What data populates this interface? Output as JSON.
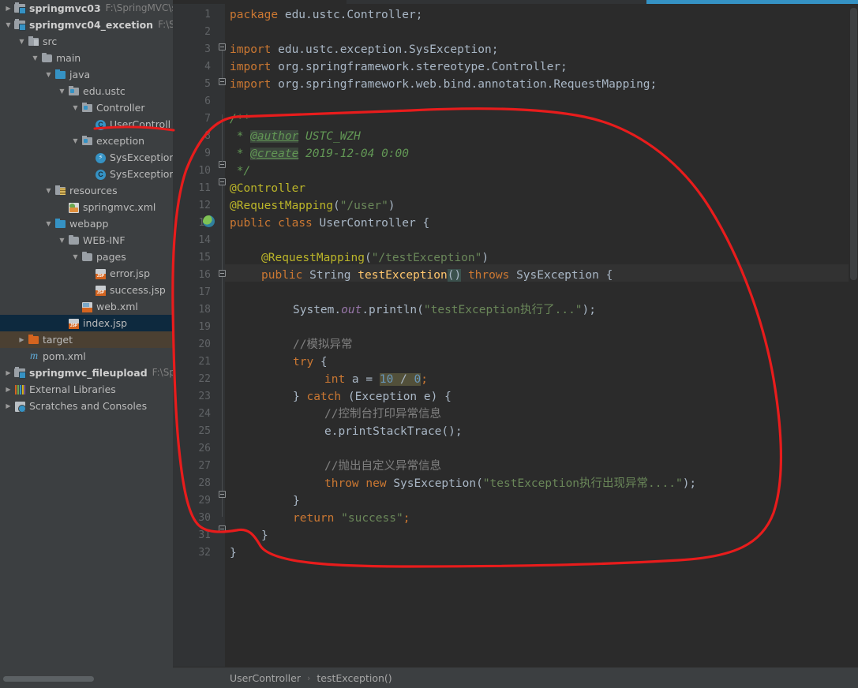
{
  "sidebar": {
    "items": [
      {
        "label": "springmvc03",
        "path": "F:\\SpringMVC\\s",
        "icon": "module-icon",
        "indent": 0,
        "arrow": "collapsed",
        "bold": true,
        "state": "normal"
      },
      {
        "label": "springmvc04_excetion",
        "path": "F:\\Spri",
        "icon": "module-icon",
        "indent": 0,
        "arrow": "expanded",
        "bold": true,
        "state": "normal"
      },
      {
        "label": "src",
        "path": "",
        "icon": "source-folder-icon",
        "indent": 1,
        "arrow": "expanded",
        "bold": false,
        "state": "normal"
      },
      {
        "label": "main",
        "path": "",
        "icon": "folder-icon",
        "indent": 2,
        "arrow": "expanded",
        "bold": false,
        "state": "normal"
      },
      {
        "label": "java",
        "path": "",
        "icon": "java-source-folder-icon",
        "indent": 3,
        "arrow": "expanded",
        "bold": false,
        "state": "normal"
      },
      {
        "label": "edu.ustc",
        "path": "",
        "icon": "package-icon",
        "indent": 4,
        "arrow": "expanded",
        "bold": false,
        "state": "normal"
      },
      {
        "label": "Controller",
        "path": "",
        "icon": "package-icon",
        "indent": 5,
        "arrow": "expanded",
        "bold": false,
        "state": "normal"
      },
      {
        "label": "UserControll",
        "path": "",
        "icon": "java-class-icon",
        "indent": 6,
        "arrow": "none",
        "bold": false,
        "state": "normal"
      },
      {
        "label": "exception",
        "path": "",
        "icon": "package-icon",
        "indent": 5,
        "arrow": "expanded",
        "bold": false,
        "state": "normal"
      },
      {
        "label": "SysException",
        "path": "",
        "icon": "exception-class-icon",
        "indent": 6,
        "arrow": "none",
        "bold": false,
        "state": "normal"
      },
      {
        "label": "SysException",
        "path": "",
        "icon": "java-class-icon",
        "indent": 6,
        "arrow": "none",
        "bold": false,
        "state": "normal"
      },
      {
        "label": "resources",
        "path": "",
        "icon": "resources-folder-icon",
        "indent": 3,
        "arrow": "expanded",
        "bold": false,
        "state": "normal"
      },
      {
        "label": "springmvc.xml",
        "path": "",
        "icon": "spring-config-icon",
        "indent": 4,
        "arrow": "none",
        "bold": false,
        "state": "normal"
      },
      {
        "label": "webapp",
        "path": "",
        "icon": "web-folder-icon",
        "indent": 3,
        "arrow": "expanded",
        "bold": false,
        "state": "normal"
      },
      {
        "label": "WEB-INF",
        "path": "",
        "icon": "folder-icon",
        "indent": 4,
        "arrow": "expanded",
        "bold": false,
        "state": "normal"
      },
      {
        "label": "pages",
        "path": "",
        "icon": "folder-icon",
        "indent": 5,
        "arrow": "expanded",
        "bold": false,
        "state": "normal"
      },
      {
        "label": "error.jsp",
        "path": "",
        "icon": "jsp-file-icon",
        "indent": 6,
        "arrow": "none",
        "bold": false,
        "state": "normal"
      },
      {
        "label": "success.jsp",
        "path": "",
        "icon": "jsp-file-icon",
        "indent": 6,
        "arrow": "none",
        "bold": false,
        "state": "normal"
      },
      {
        "label": "web.xml",
        "path": "",
        "icon": "web-xml-icon",
        "indent": 5,
        "arrow": "none",
        "bold": false,
        "state": "normal"
      },
      {
        "label": "index.jsp",
        "path": "",
        "icon": "jsp-file-icon",
        "indent": 4,
        "arrow": "none",
        "bold": false,
        "state": "selected"
      },
      {
        "label": "target",
        "path": "",
        "icon": "target-folder-icon",
        "indent": 1,
        "arrow": "collapsed",
        "bold": false,
        "state": "excluded"
      },
      {
        "label": "pom.xml",
        "path": "",
        "icon": "maven-pom-icon",
        "indent": 1,
        "arrow": "none",
        "bold": false,
        "state": "normal"
      },
      {
        "label": "springmvc_fileupload",
        "path": "F:\\Spri",
        "icon": "module-icon",
        "indent": 0,
        "arrow": "collapsed",
        "bold": true,
        "state": "normal"
      },
      {
        "label": "External Libraries",
        "path": "",
        "icon": "libraries-icon",
        "indent": 0,
        "arrow": "collapsed",
        "bold": false,
        "state": "normal"
      },
      {
        "label": "Scratches and Consoles",
        "path": "",
        "icon": "scratches-icon",
        "indent": 0,
        "arrow": "collapsed",
        "bold": false,
        "state": "normal"
      }
    ]
  },
  "editor": {
    "language": "java",
    "caret_line": 16,
    "line_numbers": [
      1,
      2,
      3,
      4,
      5,
      6,
      7,
      8,
      9,
      10,
      11,
      12,
      13,
      14,
      15,
      16,
      17,
      18,
      19,
      20,
      21,
      22,
      23,
      24,
      25,
      26,
      27,
      28,
      29,
      30,
      31,
      32
    ],
    "lines": [
      {
        "n": 1,
        "text": "package edu.ustc.Controller;"
      },
      {
        "n": 2,
        "text": ""
      },
      {
        "n": 3,
        "text": "import edu.ustc.exception.SysException;"
      },
      {
        "n": 4,
        "text": "import org.springframework.stereotype.Controller;"
      },
      {
        "n": 5,
        "text": "import org.springframework.web.bind.annotation.RequestMapping;"
      },
      {
        "n": 6,
        "text": ""
      },
      {
        "n": 7,
        "text": "/**"
      },
      {
        "n": 8,
        "text": " * @author USTC_WZH"
      },
      {
        "n": 9,
        "text": " * @create 2019-12-04 0:00"
      },
      {
        "n": 10,
        "text": " */"
      },
      {
        "n": 11,
        "text": "@Controller"
      },
      {
        "n": 12,
        "text": "@RequestMapping(\"/user\")"
      },
      {
        "n": 13,
        "text": "public class UserController {"
      },
      {
        "n": 14,
        "text": ""
      },
      {
        "n": 15,
        "text": "    @RequestMapping(\"/testException\")"
      },
      {
        "n": 16,
        "text": "    public String testException() throws SysException {"
      },
      {
        "n": 17,
        "text": ""
      },
      {
        "n": 18,
        "text": "        System.out.println(\"testException执行了...\");"
      },
      {
        "n": 19,
        "text": ""
      },
      {
        "n": 20,
        "text": "        //模拟异常"
      },
      {
        "n": 21,
        "text": "        try {"
      },
      {
        "n": 22,
        "text": "            int a = 10 / 0;"
      },
      {
        "n": 23,
        "text": "        } catch (Exception e) {"
      },
      {
        "n": 24,
        "text": "            //控制台打印异常信息"
      },
      {
        "n": 25,
        "text": "            e.printStackTrace();"
      },
      {
        "n": 26,
        "text": ""
      },
      {
        "n": 27,
        "text": "            //抛出自定义异常信息"
      },
      {
        "n": 28,
        "text": "            throw new SysException(\"testException执行出现异常....\");"
      },
      {
        "n": 29,
        "text": "        }"
      },
      {
        "n": 30,
        "text": "        return \"success\";"
      },
      {
        "n": 31,
        "text": "    }"
      },
      {
        "n": 32,
        "text": "}"
      }
    ],
    "tokens": {
      "kw_package": "package",
      "kw_import": "import",
      "kw_public": "public",
      "kw_class": "class",
      "kw_throws": "throws",
      "kw_try": "try",
      "kw_catch": "catch",
      "kw_int": "int",
      "kw_throw": "throw",
      "kw_new": "new",
      "kw_return": "return",
      "pkg_name": " edu.ustc.Controller;",
      "import1": " edu.ustc.exception.SysException;",
      "import2": " org.springframework.stereotype.",
      "import2b": "Controller;",
      "import3": " org.springframework.web.bind.annotation.",
      "import3b": "RequestMapping;",
      "jd_open": "/**",
      "jd_star": " * ",
      "jd_author_tag": "@author",
      "jd_author_val": " USTC_WZH",
      "jd_create_tag": "@create",
      "jd_create_val": " 2019-12-04 0:00",
      "jd_close": " */",
      "ann_controller": "@Controller",
      "ann_reqmap": "@RequestMapping",
      "str_user": "\"/user\"",
      "cls_usercontroller": " UserController {",
      "str_testexception_path": "\"/testException\"",
      "type_string": "String",
      "mth_testexception": "testException",
      "parens_hl": "()",
      "type_sysexception": "SysException {",
      "sys_system": "System.",
      "sys_out": "out",
      "sys_println": ".println(",
      "str_println": "\"testException执行了...\"",
      "cmt_simulate": "//模拟异常",
      "num_10": "10",
      "op_div": " / ",
      "num_0": "0",
      "catch_expr": " (Exception e) {",
      "cmt_console": "//控制台打印异常信息",
      "stmt_printstacktrace": "e.printStackTrace();",
      "cmt_throwcustom": "//抛出自定义异常信息",
      "new_sysexception": " SysException(",
      "str_sysexception_msg": "\"testException执行出现异常....\"",
      "str_success": "\"success\"",
      "brace_close": "}",
      "brace_close_indent": "    }",
      "semicolon": ";",
      "paren_close": ")",
      "try_brace": " {"
    }
  },
  "breadcrumb": {
    "class": "UserController",
    "separator": "›",
    "method": "testException()"
  },
  "annotation": {
    "tool": "red-freehand-circle",
    "color": "#e81c1c",
    "stroke_width": 3
  },
  "colors": {
    "editor_bg": "#2b2b2b",
    "gutter_bg": "#313335",
    "sidebar_bg": "#3c3f41",
    "selection_bg": "#0d293e",
    "excluded_bg": "#4b4032",
    "caret_line_bg": "#323232",
    "keyword": "#cc7832",
    "string": "#6a8759",
    "annotation_token": "#bbb529",
    "comment": "#808080",
    "javadoc": "#629755",
    "number": "#6897bb",
    "field": "#9876aa",
    "method": "#ffc66d",
    "default_text": "#a9b7c6",
    "line_number": "#606366",
    "progress_bar": "#3592c4"
  }
}
